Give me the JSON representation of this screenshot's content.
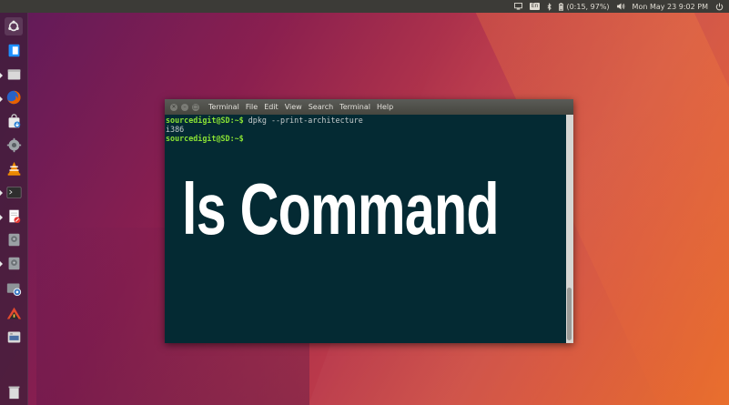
{
  "top_panel": {
    "keyboard_layout": "En",
    "battery": "(0:15, 97%)",
    "datetime": "Mon May 23  9:02 PM"
  },
  "launcher": {
    "items": [
      {
        "icon": "ubuntu-logo-icon",
        "color": "#e8e8e8"
      },
      {
        "icon": "files-app-icon",
        "color": "#1e90ff"
      },
      {
        "icon": "file-manager-icon",
        "color": "#d9d9d9"
      },
      {
        "icon": "firefox-icon",
        "color": "#e66000"
      },
      {
        "icon": "software-center-icon",
        "color": "#2a7fd4"
      },
      {
        "icon": "settings-icon",
        "color": "#9ea4a8"
      },
      {
        "icon": "vlc-icon",
        "color": "#f08c00"
      },
      {
        "icon": "terminal-icon",
        "color": "#2e2e2e"
      },
      {
        "icon": "text-editor-icon",
        "color": "#ffffff"
      },
      {
        "icon": "disk-icon",
        "color": "#9aa0a4"
      },
      {
        "icon": "disk-icon-2",
        "color": "#9aa0a4"
      },
      {
        "icon": "screenshot-tool-icon",
        "color": "#8e9498"
      },
      {
        "icon": "warning-app-icon",
        "color": "#e34a2e"
      },
      {
        "icon": "drive-icon",
        "color": "#d8d8d8"
      },
      {
        "icon": "trash-icon",
        "color": "#dcdcdc"
      }
    ]
  },
  "terminal": {
    "title": "Terminal",
    "menu": [
      "File",
      "Edit",
      "View",
      "Search",
      "Terminal",
      "Help"
    ],
    "lines": [
      {
        "prompt": "sourcedigit@SD:~$",
        "text": " dpkg --print-architecture"
      },
      {
        "prompt": "",
        "text": "i386"
      },
      {
        "prompt": "sourcedigit@SD:~$",
        "text": ""
      }
    ]
  },
  "overlay": {
    "title": "ls Command"
  },
  "colors": {
    "prompt": "#8ae234",
    "terminal_bg": "#042a33",
    "panel_bg": "#3c3b37"
  }
}
